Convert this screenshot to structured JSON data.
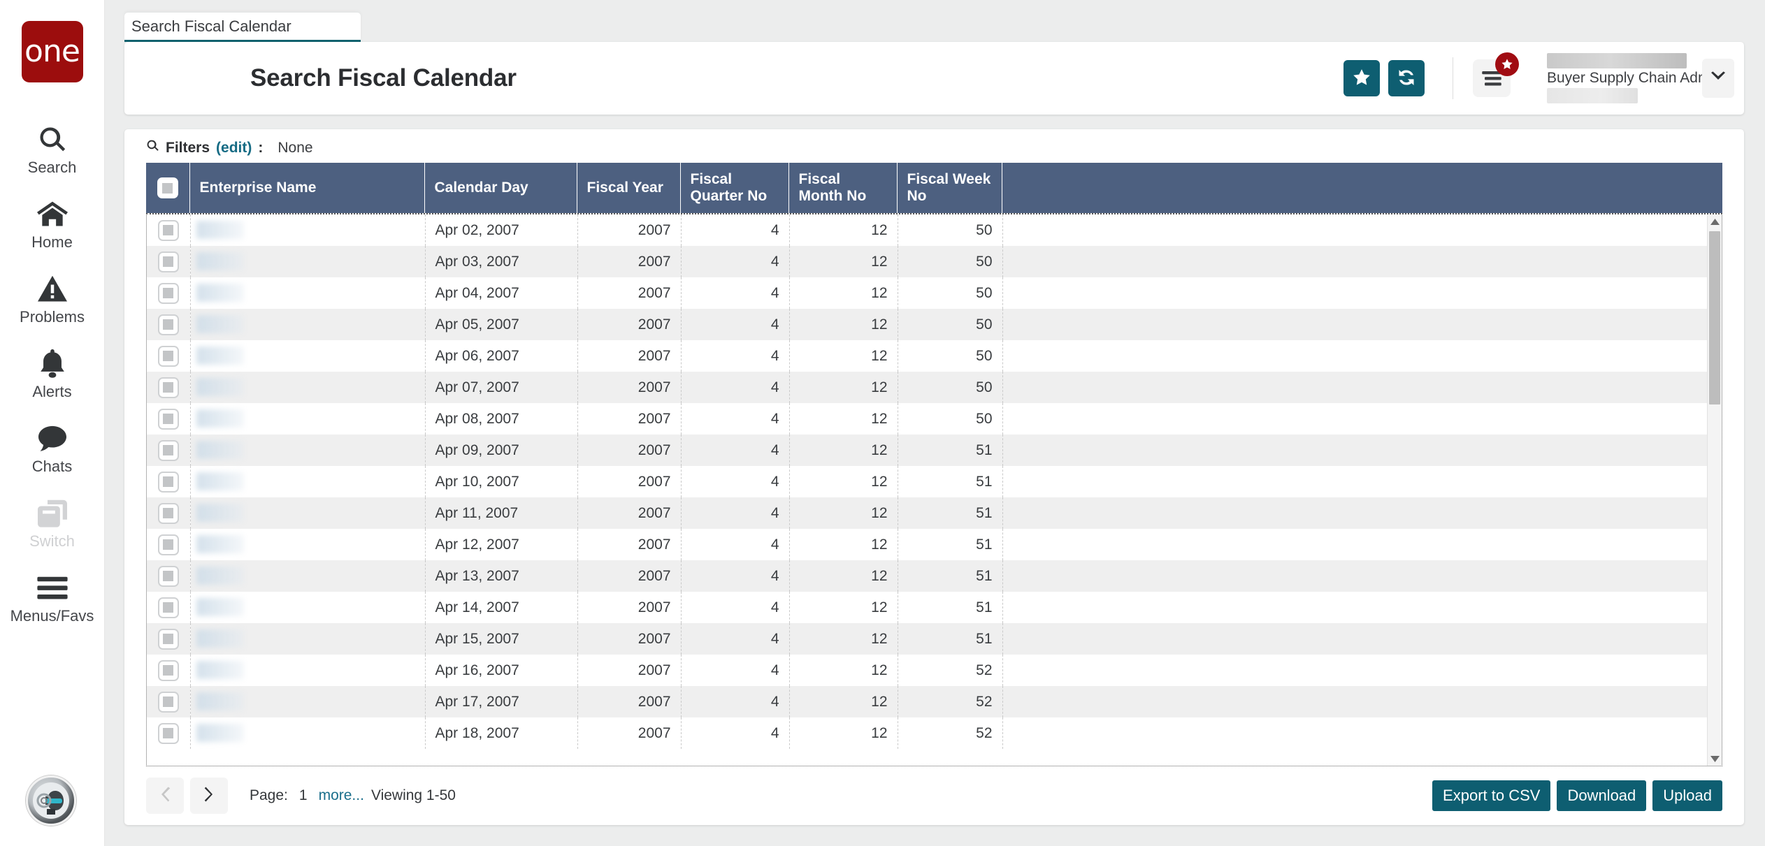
{
  "brand": {
    "logo_text": "one",
    "logo_color": "#9c0d0d",
    "accent_color": "#0e5e71",
    "header_bg": "#4d6080"
  },
  "sidebar": {
    "items": [
      {
        "label": "Search",
        "icon": "search-icon",
        "disabled": false
      },
      {
        "label": "Home",
        "icon": "home-icon",
        "disabled": false
      },
      {
        "label": "Problems",
        "icon": "warning-icon",
        "disabled": false
      },
      {
        "label": "Alerts",
        "icon": "bell-icon",
        "disabled": false
      },
      {
        "label": "Chats",
        "icon": "chat-icon",
        "disabled": false
      },
      {
        "label": "Switch",
        "icon": "switch-icon",
        "disabled": true
      },
      {
        "label": "Menus/Favs",
        "icon": "hamburger-icon",
        "disabled": false
      }
    ],
    "avatar_name": "user-avatar"
  },
  "tab": {
    "label": "Search Fiscal Calendar"
  },
  "header": {
    "title": "Search Fiscal Calendar",
    "favorite_icon": "star-icon",
    "refresh_icon": "refresh-icon",
    "menu_icon": "menu-list-icon",
    "badge_icon": "star-badge-icon",
    "user_role": "Buyer Supply Chain Admin",
    "caret_icon": "chevron-down-icon"
  },
  "filters": {
    "search_icon": "search-icon",
    "label": "Filters",
    "edit_label": "(edit)",
    "colon": ":",
    "value": "None"
  },
  "table": {
    "select_all_name": "select-all-checkbox",
    "columns": [
      {
        "label": "Enterprise Name",
        "align": "left"
      },
      {
        "label": "Calendar Day",
        "align": "left"
      },
      {
        "label": "Fiscal Year",
        "align": "right"
      },
      {
        "label": "Fiscal Quarter No",
        "align": "right"
      },
      {
        "label": "Fiscal Month No",
        "align": "right"
      },
      {
        "label": "Fiscal Week No",
        "align": "right"
      }
    ],
    "rows": [
      {
        "enterprise": "",
        "calendar_day": "Apr 02, 2007",
        "fiscal_year": "2007",
        "fiscal_quarter_no": "4",
        "fiscal_month_no": "12",
        "fiscal_week_no": "50"
      },
      {
        "enterprise": "",
        "calendar_day": "Apr 03, 2007",
        "fiscal_year": "2007",
        "fiscal_quarter_no": "4",
        "fiscal_month_no": "12",
        "fiscal_week_no": "50"
      },
      {
        "enterprise": "",
        "calendar_day": "Apr 04, 2007",
        "fiscal_year": "2007",
        "fiscal_quarter_no": "4",
        "fiscal_month_no": "12",
        "fiscal_week_no": "50"
      },
      {
        "enterprise": "",
        "calendar_day": "Apr 05, 2007",
        "fiscal_year": "2007",
        "fiscal_quarter_no": "4",
        "fiscal_month_no": "12",
        "fiscal_week_no": "50"
      },
      {
        "enterprise": "",
        "calendar_day": "Apr 06, 2007",
        "fiscal_year": "2007",
        "fiscal_quarter_no": "4",
        "fiscal_month_no": "12",
        "fiscal_week_no": "50"
      },
      {
        "enterprise": "",
        "calendar_day": "Apr 07, 2007",
        "fiscal_year": "2007",
        "fiscal_quarter_no": "4",
        "fiscal_month_no": "12",
        "fiscal_week_no": "50"
      },
      {
        "enterprise": "",
        "calendar_day": "Apr 08, 2007",
        "fiscal_year": "2007",
        "fiscal_quarter_no": "4",
        "fiscal_month_no": "12",
        "fiscal_week_no": "50"
      },
      {
        "enterprise": "",
        "calendar_day": "Apr 09, 2007",
        "fiscal_year": "2007",
        "fiscal_quarter_no": "4",
        "fiscal_month_no": "12",
        "fiscal_week_no": "51"
      },
      {
        "enterprise": "",
        "calendar_day": "Apr 10, 2007",
        "fiscal_year": "2007",
        "fiscal_quarter_no": "4",
        "fiscal_month_no": "12",
        "fiscal_week_no": "51"
      },
      {
        "enterprise": "",
        "calendar_day": "Apr 11, 2007",
        "fiscal_year": "2007",
        "fiscal_quarter_no": "4",
        "fiscal_month_no": "12",
        "fiscal_week_no": "51"
      },
      {
        "enterprise": "",
        "calendar_day": "Apr 12, 2007",
        "fiscal_year": "2007",
        "fiscal_quarter_no": "4",
        "fiscal_month_no": "12",
        "fiscal_week_no": "51"
      },
      {
        "enterprise": "",
        "calendar_day": "Apr 13, 2007",
        "fiscal_year": "2007",
        "fiscal_quarter_no": "4",
        "fiscal_month_no": "12",
        "fiscal_week_no": "51"
      },
      {
        "enterprise": "",
        "calendar_day": "Apr 14, 2007",
        "fiscal_year": "2007",
        "fiscal_quarter_no": "4",
        "fiscal_month_no": "12",
        "fiscal_week_no": "51"
      },
      {
        "enterprise": "",
        "calendar_day": "Apr 15, 2007",
        "fiscal_year": "2007",
        "fiscal_quarter_no": "4",
        "fiscal_month_no": "12",
        "fiscal_week_no": "51"
      },
      {
        "enterprise": "",
        "calendar_day": "Apr 16, 2007",
        "fiscal_year": "2007",
        "fiscal_quarter_no": "4",
        "fiscal_month_no": "12",
        "fiscal_week_no": "52"
      },
      {
        "enterprise": "",
        "calendar_day": "Apr 17, 2007",
        "fiscal_year": "2007",
        "fiscal_quarter_no": "4",
        "fiscal_month_no": "12",
        "fiscal_week_no": "52"
      },
      {
        "enterprise": "",
        "calendar_day": "Apr 18, 2007",
        "fiscal_year": "2007",
        "fiscal_quarter_no": "4",
        "fiscal_month_no": "12",
        "fiscal_week_no": "52"
      }
    ]
  },
  "footer": {
    "prev_icon": "chevron-left-icon",
    "next_icon": "chevron-right-icon",
    "page_label": "Page:",
    "page_number": "1",
    "more_label": "more...",
    "viewing_label": "Viewing 1-50",
    "export_label": "Export to CSV",
    "download_label": "Download",
    "upload_label": "Upload"
  }
}
